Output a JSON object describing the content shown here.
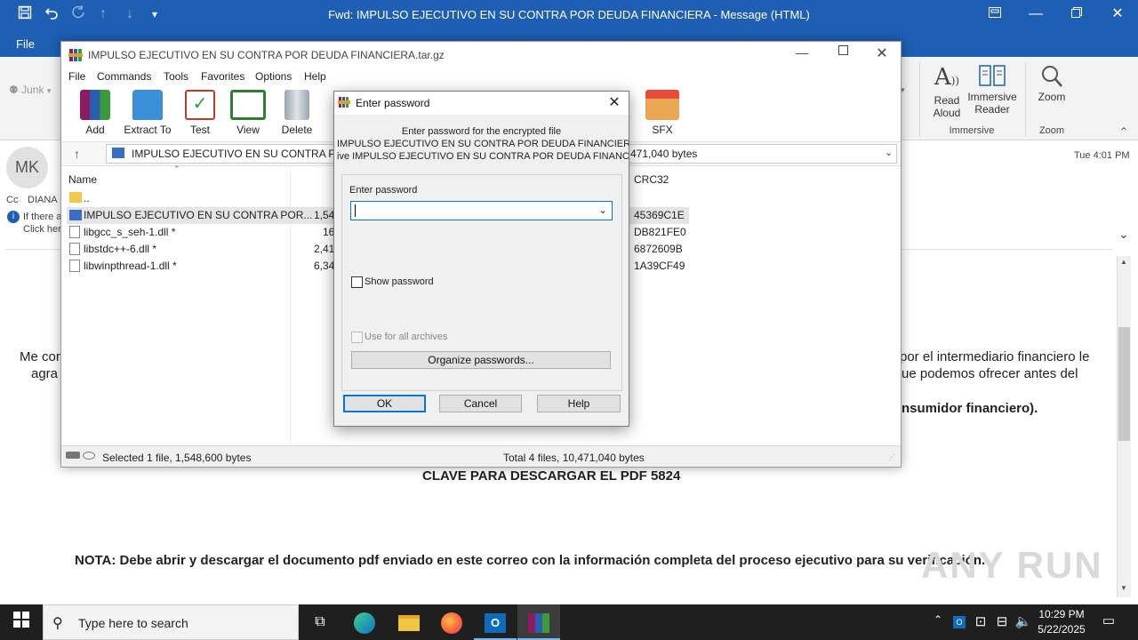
{
  "outlook": {
    "window_title": "Fwd: IMPULSO EJECUTIVO EN SU CONTRA POR DEUDA FINANCIERA  -  Message (HTML)",
    "file_tab": "File",
    "junk_label": "Junk",
    "ribbon": {
      "read_aloud": [
        "Read",
        "Aloud"
      ],
      "immersive_reader": [
        "Immersive",
        "Reader"
      ],
      "zoom": "Zoom",
      "group_immersive": "Immersive",
      "group_zoom": "Zoom"
    },
    "avatar_initials": "MK",
    "cc_label": "Cc",
    "cc_value": "DIANA",
    "info_line1": "If there a",
    "info_line2": "Click her",
    "timestamp": "Tue 4:01 PM",
    "body": {
      "left_fragment1": "Me cor",
      "left_fragment2": "agra",
      "right_fragment1": "por el intermediario financiero le",
      "right_fragment2": "ue podemos ofrecer antes del",
      "right_fragment3": "nsumidor financiero).",
      "clave_line": "CLAVE PARA DESCARGAR EL PDF 5824",
      "nota_line": "NOTA: Debe abrir y descargar el documento pdf enviado en este correo con la información completa del proceso ejecutivo para su verificación."
    },
    "watermark": "ANY RUN"
  },
  "winrar": {
    "title": "IMPULSO EJECUTIVO EN SU CONTRA POR DEUDA FINANCIERA.tar.gz",
    "menu": [
      "File",
      "Commands",
      "Tools",
      "Favorites",
      "Options",
      "Help"
    ],
    "toolbar": {
      "add": "Add",
      "extract_to": "Extract To",
      "test": "Test",
      "view": "View",
      "delete": "Delete",
      "sfx": "SFX"
    },
    "address": "IMPULSO EJECUTIVO EN SU CONTRA POR",
    "address_size": "471,040 bytes",
    "columns": {
      "name": "Name",
      "crc": "CRC32"
    },
    "files": [
      {
        "name": "..",
        "size": "",
        "crc": ""
      },
      {
        "name": "IMPULSO EJECUTIVO EN SU CONTRA POR...",
        "size": "1,54",
        "crc": "45369C1E"
      },
      {
        "name": "libgcc_s_seh-1.dll *",
        "size": "16",
        "crc": "DB821FE0"
      },
      {
        "name": "libstdc++-6.dll *",
        "size": "2,41",
        "crc": "6872609B"
      },
      {
        "name": "libwinpthread-1.dll *",
        "size": "6,34",
        "crc": "1A39CF49"
      }
    ],
    "status_left": "Selected 1 file, 1,548,600 bytes",
    "status_right": "Total 4 files, 10,471,040 bytes"
  },
  "dialog": {
    "title": "Enter password",
    "info_line1": "Enter password for the encrypted file",
    "info_line2": "IMPULSO EJECUTIVO EN SU CONTRA POR DEUDA FINANCIERA.exe",
    "info_line3": "ive IMPULSO EJECUTIVO EN SU CONTRA POR DEUDA FINANCIERA.",
    "field_label": "Enter password",
    "field_value": "",
    "show_password": "Show password",
    "use_for_all": "Use for all archives",
    "organize": "Organize passwords...",
    "ok": "OK",
    "cancel": "Cancel",
    "help": "Help"
  },
  "taskbar": {
    "search_placeholder": "Type here to search",
    "time": "10:29 PM",
    "date": "5/22/2025"
  }
}
